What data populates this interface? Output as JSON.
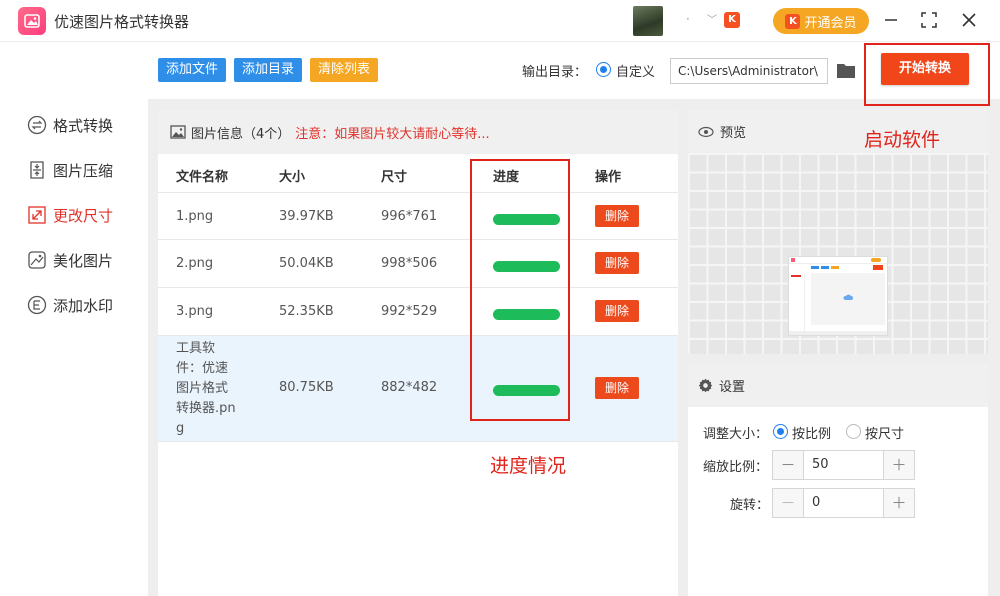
{
  "app": {
    "title": "优速图片格式转换器"
  },
  "user": {
    "name": "·",
    "chevron": "﹀",
    "badge": "K"
  },
  "header": {
    "vip_label": "开通会员",
    "vip_badge": "K"
  },
  "sidebar": {
    "items": [
      {
        "label": "格式转换",
        "icon": "format-convert-icon",
        "active": false
      },
      {
        "label": "图片压缩",
        "icon": "compress-icon",
        "active": false
      },
      {
        "label": "更改尺寸",
        "icon": "resize-icon",
        "active": true
      },
      {
        "label": "美化图片",
        "icon": "beautify-icon",
        "active": false
      },
      {
        "label": "添加水印",
        "icon": "watermark-icon",
        "active": false
      }
    ]
  },
  "toolbar": {
    "add_file": "添加文件",
    "add_folder": "添加目录",
    "clear_list": "清除列表",
    "output_label": "输出目录：",
    "output_option": "自定义",
    "output_path": "C:\\Users\\Administrator\\",
    "start_label": "开始转换",
    "colors": {
      "add": "#2f8fe8",
      "clear": "#f5a623",
      "start": "#f0461a"
    }
  },
  "file_panel": {
    "header_prefix": "图片信息（4个）",
    "header_notice": "注意：如果图片较大请耐心等待...",
    "columns": [
      "文件名称",
      "大小",
      "尺寸",
      "进度",
      "操作"
    ],
    "rows": [
      {
        "name": "1.png",
        "size": "39.97KB",
        "dims": "996*761",
        "progress": 1.0,
        "action": "删除"
      },
      {
        "name": "2.png",
        "size": "50.04KB",
        "dims": "998*506",
        "progress": 1.0,
        "action": "删除"
      },
      {
        "name": "3.png",
        "size": "52.35KB",
        "dims": "992*529",
        "progress": 1.0,
        "action": "删除"
      },
      {
        "name": "工具软件：优速图片格式转换器.png",
        "name_lines": [
          "工具软",
          "件：优速",
          "图片格式",
          "转换器.pn",
          "g"
        ],
        "size": "80.75KB",
        "dims": "882*482",
        "progress": 1.0,
        "action": "删除",
        "selected": true
      }
    ]
  },
  "preview": {
    "title": "预览"
  },
  "settings": {
    "title": "设置",
    "resize_label": "调整大小：",
    "resize_options": [
      "按比例",
      "按尺寸"
    ],
    "resize_selected": 0,
    "scale_label": "缩放比例：",
    "scale_value": "50",
    "rotate_label": "旋转：",
    "rotate_value": "0",
    "minus": "－",
    "plus": "＋"
  },
  "annotations": {
    "start": "启动软件",
    "progress": "进度情况",
    "color": "#e0241b"
  }
}
